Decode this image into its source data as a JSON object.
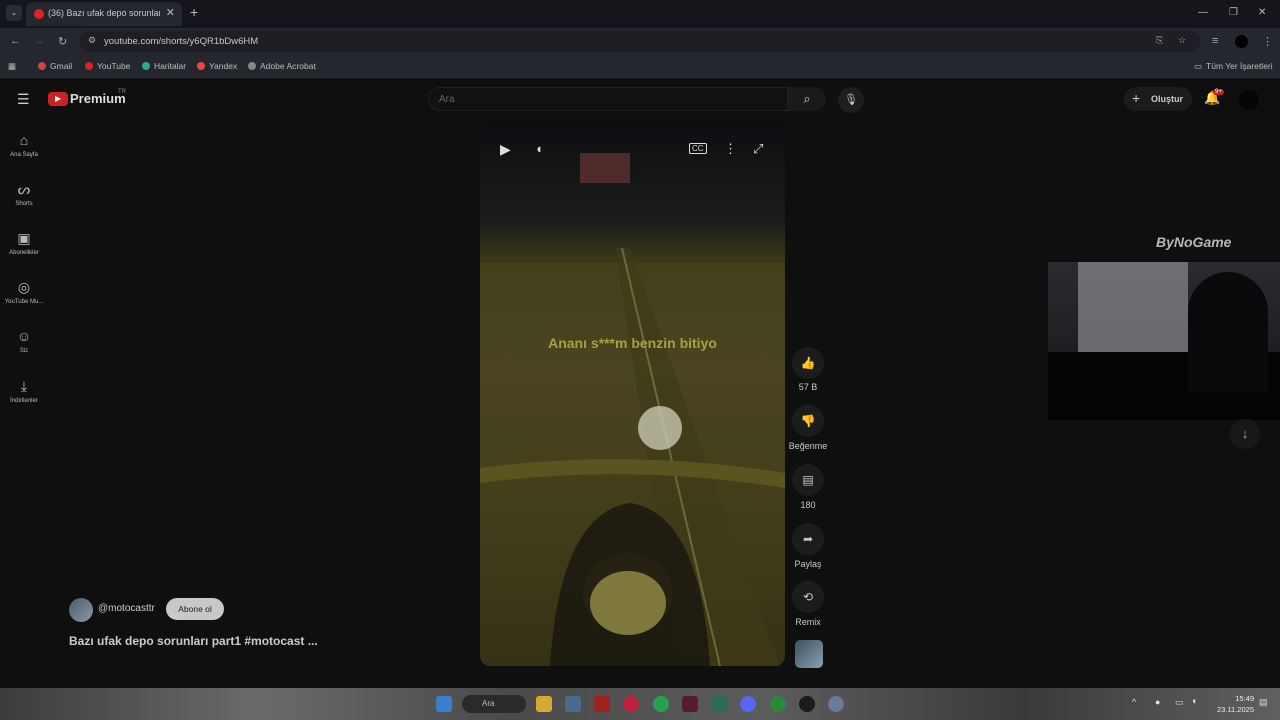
{
  "browser": {
    "tab_title": "(36) Bazı ufak depo sorunları p...",
    "url": "youtube.com/shorts/y6QR1bDw6HM",
    "bookmarks": [
      "Gmail",
      "YouTube",
      "Haritalar",
      "Yandex",
      "Adobe Acrobat"
    ],
    "all_bookmarks": "Tüm Yer İşaretleri"
  },
  "youtube": {
    "logo_text": "Premium",
    "logo_region": "TR",
    "search_placeholder": "Ara",
    "create_label": "Oluştur",
    "notif_count": "9+",
    "sidebar": [
      {
        "label": "Ana Sayfa",
        "icon": "home-icon"
      },
      {
        "label": "Shorts",
        "icon": "shorts-icon"
      },
      {
        "label": "Abonelikler",
        "icon": "subscriptions-icon"
      },
      {
        "label": "YouTube Mu...",
        "icon": "youtube-music-icon"
      },
      {
        "label": "Siz",
        "icon": "user-icon"
      },
      {
        "label": "İndirilenler",
        "icon": "download-icon"
      }
    ],
    "channel": "@motocasttr",
    "subscribe_label": "Abone ol",
    "video_title": "Bazı ufak depo sorunları part1 #motocast ...",
    "subtitle": "Ananı s***m benzin bitiyo",
    "actions": {
      "likes": "57 B",
      "dislike_label": "Beğenme",
      "comments": "180",
      "share_label": "Paylaş",
      "remix_label": "Remix"
    },
    "overlay_brand": "ByNoGame"
  },
  "taskbar": {
    "search_label": "Ara",
    "time": "15:49",
    "date": "23.11.2025"
  }
}
